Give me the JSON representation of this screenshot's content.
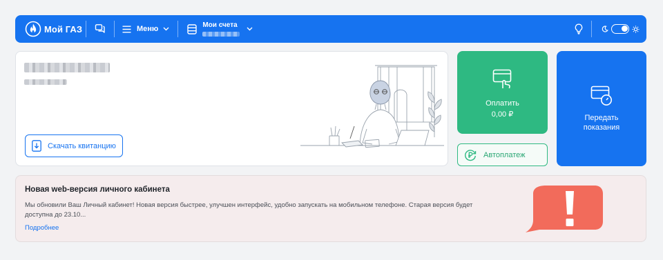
{
  "header": {
    "logo_text": "Мой ГАЗ",
    "logo_icon": "gas-flame-icon",
    "chat_icon": "chat-icon",
    "menu_label": "Меню",
    "accounts_label": "Мои счета",
    "bulb_icon": "lightbulb-icon",
    "theme_icons": [
      "moon-icon",
      "sun-icon"
    ],
    "brand_color": "#1673f0"
  },
  "info_card": {
    "download_button": "Скачать квитанцию"
  },
  "pay_card": {
    "label": "Оплатить",
    "amount": "0,00 ₽",
    "color": "#2eb982"
  },
  "autopay": {
    "label": "Автоплатеж"
  },
  "meter_card": {
    "label": "Передать показания"
  },
  "notice": {
    "title": "Новая web-версия личного кабинета",
    "text": "Мы обновили Ваш Личный кабинет! Новая версия быстрее, улучшен интерфейс, удобно запускать на мобильном телефоне. Старая версия будет доступна до 23.10...",
    "link": "Подробнее",
    "alert_color": "#f26b5b"
  }
}
